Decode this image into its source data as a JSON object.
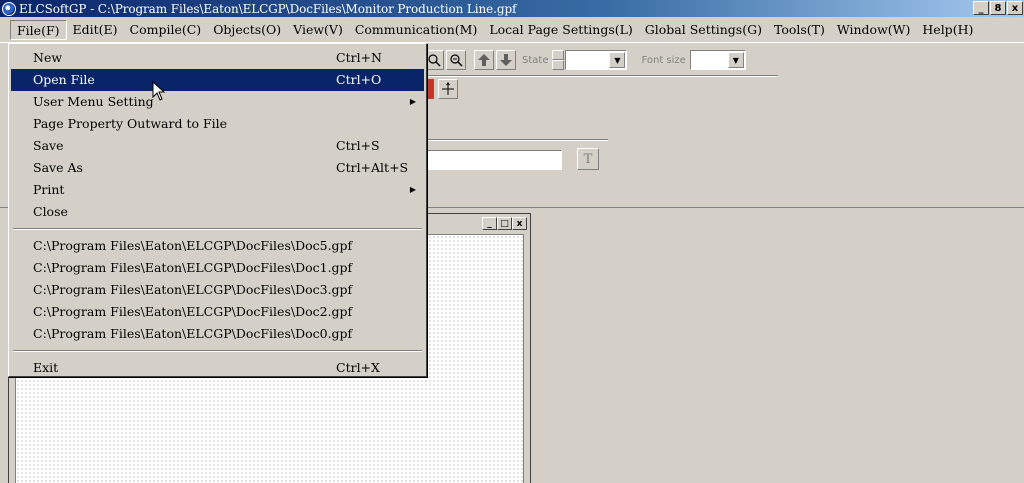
{
  "window": {
    "title": "ELCSoftGP - C:\\Program Files\\Eaton\\ELCGP\\DocFiles\\Monitor Production Line.gpf",
    "buttons": [
      "_",
      "8",
      "x"
    ]
  },
  "menubar": {
    "items": [
      "File(F)",
      "Edit(E)",
      "Compile(C)",
      "Objects(O)",
      "View(V)",
      "Communication(M)",
      "Local Page Settings(L)",
      "Global Settings(G)",
      "Tools(T)",
      "Window(W)",
      "Help(H)"
    ]
  },
  "toolbar": {
    "state_label": "State",
    "font_size_label": "Font size",
    "text_tool": "T"
  },
  "file_menu": {
    "items": [
      {
        "label": "New",
        "shortcut": "Ctrl+N"
      },
      {
        "label": "Open File",
        "shortcut": "Ctrl+O",
        "highlighted": true
      },
      {
        "label": "User Menu Setting",
        "submenu": true
      },
      {
        "label": "Page Property Outward to File"
      },
      {
        "label": "Save",
        "shortcut": "Ctrl+S"
      },
      {
        "label": "Save As",
        "shortcut": "Ctrl+Alt+S"
      },
      {
        "label": "Print",
        "submenu": true
      },
      {
        "label": "Close"
      }
    ],
    "recent": [
      "C:\\Program Files\\Eaton\\ELCGP\\DocFiles\\Doc5.gpf",
      "C:\\Program Files\\Eaton\\ELCGP\\DocFiles\\Doc1.gpf",
      "C:\\Program Files\\Eaton\\ELCGP\\DocFiles\\Doc3.gpf",
      "C:\\Program Files\\Eaton\\ELCGP\\DocFiles\\Doc2.gpf",
      "C:\\Program Files\\Eaton\\ELCGP\\DocFiles\\Doc0.gpf"
    ],
    "exit": {
      "label": "Exit",
      "shortcut": "Ctrl+X"
    }
  },
  "child_window": {
    "buttons": [
      "_",
      "□",
      "x"
    ]
  },
  "icons": {
    "app": "app-logo-icon",
    "zoom_in": "zoom-in-icon",
    "zoom_out": "zoom-out-icon",
    "bring_forward": "arrow-up-icon",
    "send_backward": "arrow-down-icon",
    "cursor": "mouse-pointer-icon"
  },
  "colors": {
    "title_active": "#0a246a",
    "menu_highlight": "#0a246a",
    "face": "#d4d0c8"
  }
}
